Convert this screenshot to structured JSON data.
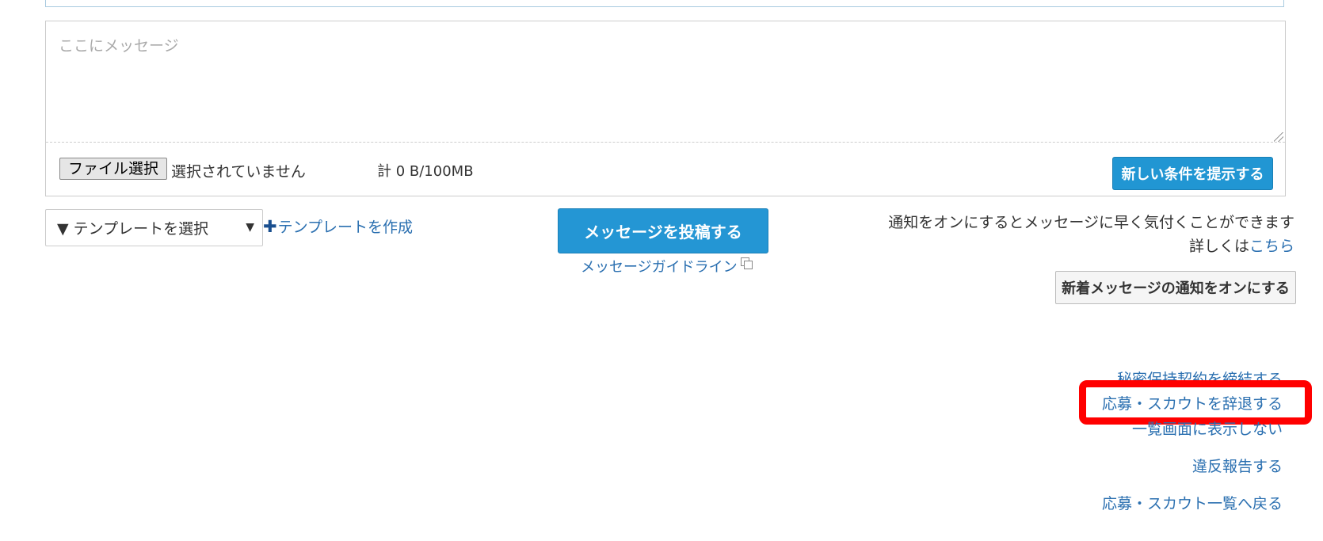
{
  "compose": {
    "message_placeholder": "ここにメッセージ",
    "file_button_label": "ファイル選択",
    "file_status": "選択されていません",
    "size_total": "計 0 B/100MB",
    "propose_button_label": "新しい条件を提示する"
  },
  "template": {
    "select_label": "▼ テンプレートを選択",
    "caret": "▼",
    "create_plus": "✚",
    "create_label": "テンプレートを作成"
  },
  "post": {
    "button_label": "メッセージを投稿する",
    "guideline_label": "メッセージガイドライン",
    "guideline_icon": "external-window-icon"
  },
  "notification": {
    "line1": "通知をオンにするとメッセージに早く気付くことができます",
    "line2_prefix": "詳しくは",
    "line2_link": "こちら",
    "button_label": "新着メッセージの通知をオンにする"
  },
  "actions": {
    "nda": "秘密保持契約を締結する",
    "decline": "応募・スカウトを辞退する",
    "hide": "一覧画面に表示しない",
    "report": "違反報告する",
    "back": "応募・スカウト一覧へ戻る"
  },
  "highlight_color": "#ff0000",
  "accent_color": "#2496d4",
  "link_color": "#2a6fb0"
}
